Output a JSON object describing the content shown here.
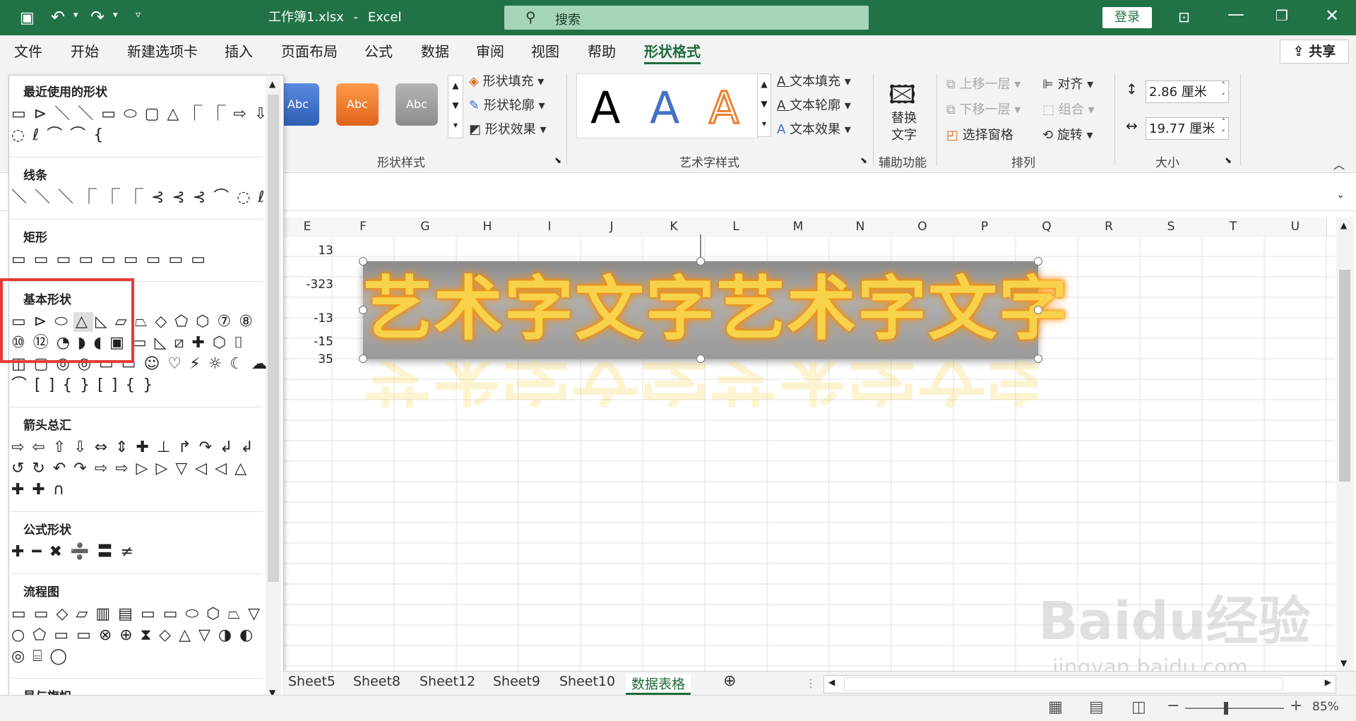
{
  "titlebar": {
    "filename": "工作簿1.xlsx",
    "sep": "-",
    "app": "Excel",
    "search_placeholder": "搜索",
    "login": "登录"
  },
  "menu": {
    "tabs": [
      "文件",
      "开始",
      "新建选项卡",
      "插入",
      "页面布局",
      "公式",
      "数据",
      "审阅",
      "视图",
      "帮助"
    ],
    "active_tab": "形状格式",
    "share": "共享"
  },
  "ribbon": {
    "style_buttons": [
      "Abc",
      "Abc",
      "Abc"
    ],
    "shape_fill": "形状填充",
    "shape_outline": "形状轮廓",
    "shape_effects": "形状效果",
    "group_shape_styles": "形状样式",
    "wordart_letters": [
      "A",
      "A",
      "A"
    ],
    "text_fill": "文本填充",
    "text_outline": "文本轮廓",
    "text_effects": "文本效果",
    "group_wordart": "艺术字样式",
    "alt_text_1": "替换",
    "alt_text_2": "文字",
    "group_accessibility": "辅助功能",
    "bring_forward": "上移一层",
    "send_backward": "下移一层",
    "selection_pane": "选择窗格",
    "align": "对齐",
    "group": "组合",
    "rotate": "旋转",
    "group_arrange": "排列",
    "height": "2.86 厘米",
    "width": "19.77 厘米",
    "group_size": "大小"
  },
  "grid": {
    "columns": [
      "E",
      "F",
      "G",
      "H",
      "I",
      "J",
      "K",
      "L",
      "M",
      "N",
      "O",
      "P",
      "Q",
      "R",
      "S",
      "T",
      "U"
    ],
    "values": [
      "13",
      "-323",
      "-13",
      "-15",
      "35"
    ]
  },
  "wordart_text": "艺术字文字艺术字文字",
  "shapes_panel": {
    "sections": [
      "最近使用的形状",
      "线条",
      "矩形",
      "基本形状",
      "箭头总汇",
      "公式形状",
      "流程图",
      "星与旗帜"
    ],
    "rows": {
      "recent_1": "▭ ⊳ ＼ ＼ ▭ ⬭ ▢ △ ⎾ ⎾ ⇨ ⇩",
      "recent_2": "◌ ℓ ⌒ ⌒ {",
      "lines": "＼ ＼ ＼ ⎾ ⎾ ⎾ ⊰ ⊰ ⊰ ⌒ ◌ ℓ",
      "rects": "▭ ▭ ▭ ▭ ▭ ▭ ▭ ▭ ▭",
      "basic_1": "▭ ⊳ ⬭ △ ◺ ▱ ⏢ ◇ ⬠ ⬡ ⑦ ⑧",
      "basic_2": "⑩ ⑫ ◔ ◗ ◖ ▣ ▭ ◺ ⧄ ✚ ⬡ ⌷",
      "basic_3": "◫ ▢ ◎ ◎ ▭ ▭ ☺ ♡ ⚡ ☼ ☾ ☁",
      "basic_4": "⌒ [ ] { } [ ] { }",
      "arrows_1": "⇨ ⇦ ⇧ ⇩ ⇔ ⇕ ✚ ⊥ ↱ ↷ ↲ ↲",
      "arrows_2": "↺ ↻ ↶ ↷ ⇨ ⇨ ▷ ▷ ▽ ◁ ◁ △",
      "arrows_3": "✚ ✚ ∩",
      "equation": "✚ ━ ✖ ➗ 〓 ≠",
      "flow_1": "▭ ▭ ◇ ▱ ▥ ▤ ▭ ▭ ⬭ ⬡ ⏢ ▽",
      "flow_2": "○ ⬠ ▭ ▭ ⊗ ⊕ ⧗ ◇ △ ▽ ◑ ◐",
      "flow_3": "◎ ⌸ ◯",
      "stars": ""
    }
  },
  "sheets": {
    "tabs": [
      "Sheet5",
      "Sheet8",
      "Sheet12",
      "Sheet9",
      "Sheet10"
    ],
    "active": "数据表格",
    "add": "⊕"
  },
  "status": {
    "zoom": "85%"
  },
  "watermark": {
    "line1": "Baidu经验",
    "line2": "jingyan.baidu.com"
  }
}
